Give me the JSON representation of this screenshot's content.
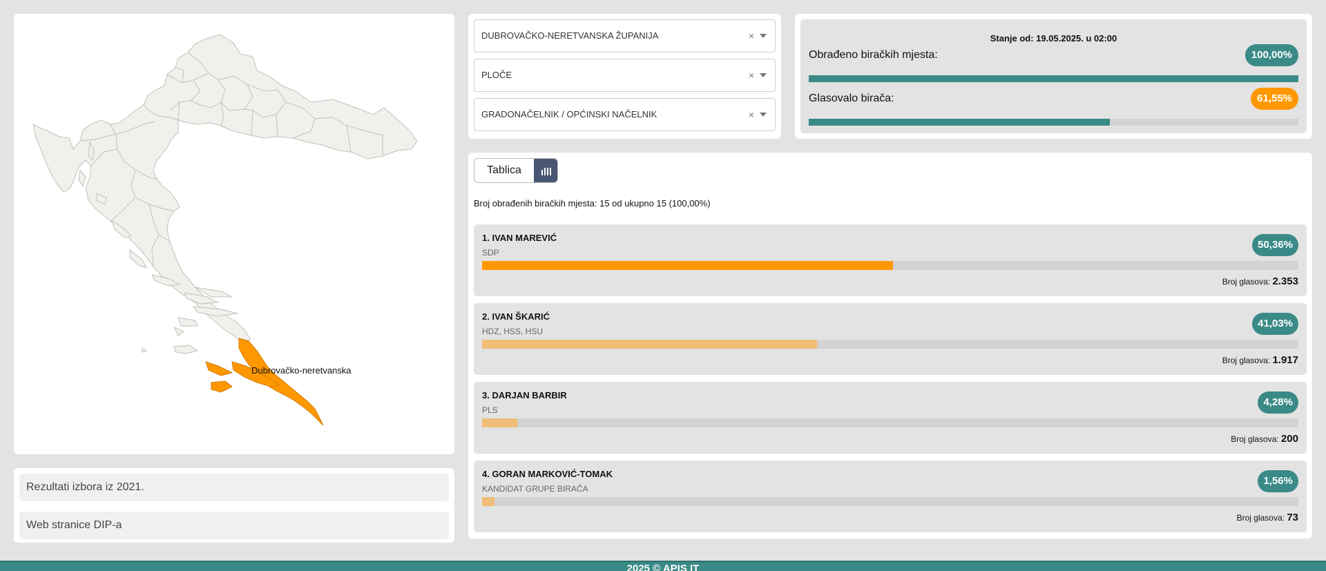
{
  "map": {
    "selected_region_label": "Dubrovačko-neretvanska",
    "colors": {
      "selected": "#ff9800",
      "region": "#f1f0ec"
    }
  },
  "links": [
    {
      "label": "Rezultati izbora iz 2021."
    },
    {
      "label": "Web stranice DIP-a"
    }
  ],
  "selectors": [
    {
      "value": "DUBROVAČKO-NERETVANSKA ŽUPANIJA",
      "clear": "×"
    },
    {
      "value": "PLOČE",
      "clear": "×"
    },
    {
      "value": "GRADONAČELNIK / OPĆINSKI NAČELNIK",
      "clear": "×"
    }
  ],
  "status": {
    "date": "Stanje od: 19.05.2025. u 02:00",
    "processed_label": "Obrađeno biračkih mjesta:",
    "processed_value": "100,00%",
    "processed_fraction": 1.0,
    "turnout_label": "Glasovalo birača:",
    "turnout_value": "61,55%",
    "turnout_fraction": 0.6155
  },
  "results": {
    "view_table_label": "Tablica",
    "counted_text": "Broj obrađenih biračkih mjesta: 15 od ukupno 15 (100,00%)",
    "votes_label": "Broj glasova:",
    "candidates": [
      {
        "name": "1. IVAN MAREVIĆ",
        "party": "SDP",
        "percent": "50,36%",
        "fraction": 0.5036,
        "votes": "2.353",
        "bar_color": "#ff9800"
      },
      {
        "name": "2. IVAN ŠKARIĆ",
        "party": "HDZ, HSS, HSU",
        "percent": "41,03%",
        "fraction": 0.4103,
        "votes": "1.917",
        "bar_color": "#f0bd78"
      },
      {
        "name": "3. DARJAN BARBIR",
        "party": "PLS",
        "percent": "4,28%",
        "fraction": 0.0428,
        "votes": "200",
        "bar_color": "#f0bd78"
      },
      {
        "name": "4. GORAN MARKOVIĆ-TOMAK",
        "party": "KANDIDAT GRUPE BIRAČA",
        "percent": "1,56%",
        "fraction": 0.0156,
        "votes": "73",
        "bar_color": "#f0bd78"
      }
    ]
  },
  "footer": {
    "text": "2025 © APIS IT"
  }
}
